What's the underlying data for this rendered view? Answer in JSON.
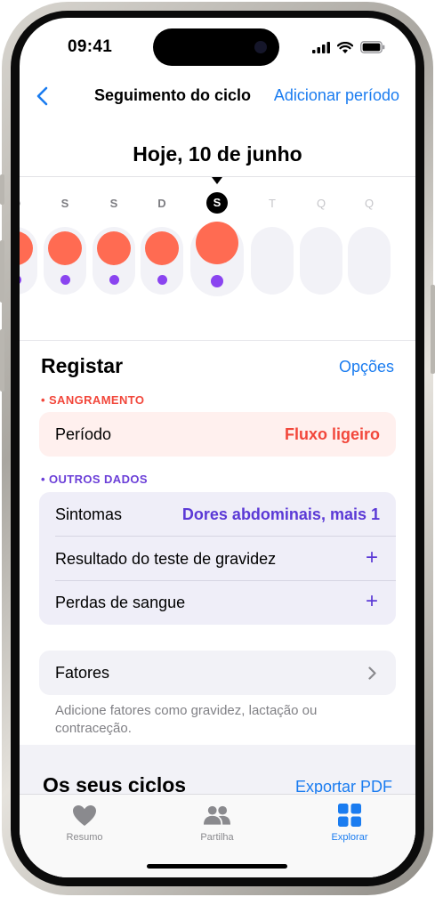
{
  "status_bar": {
    "time": "09:41"
  },
  "nav": {
    "back_icon": "chevron-left-icon",
    "title": "Seguimento do ciclo",
    "action": "Adicionar período"
  },
  "calendar": {
    "date_heading": "Hoje, 10 de junho",
    "days": [
      {
        "weekday": "Q",
        "state": "past",
        "flow": true,
        "symptom": true
      },
      {
        "weekday": "S",
        "state": "past",
        "flow": true,
        "symptom": true
      },
      {
        "weekday": "S",
        "state": "past",
        "flow": true,
        "symptom": true
      },
      {
        "weekday": "D",
        "state": "past",
        "flow": true,
        "symptom": true
      },
      {
        "weekday": "S",
        "state": "today",
        "flow": true,
        "symptom": true
      },
      {
        "weekday": "T",
        "state": "future",
        "flow": false,
        "symptom": false
      },
      {
        "weekday": "Q",
        "state": "future",
        "flow": false,
        "symptom": false
      },
      {
        "weekday": "Q",
        "state": "future",
        "flow": false,
        "symptom": false
      }
    ],
    "colors": {
      "flow": "#ff6b52",
      "symptom": "#8a44f0",
      "pill": "#f2f2f7"
    }
  },
  "log": {
    "title": "Registar",
    "options": "Opções",
    "bleeding": {
      "label": "SANGRAMENTO",
      "rows": [
        {
          "label": "Período",
          "value": "Fluxo ligeiro"
        }
      ]
    },
    "other": {
      "label": "OUTROS DADOS",
      "rows": [
        {
          "label": "Sintomas",
          "value": "Dores abdominais, mais 1"
        },
        {
          "label": "Resultado do teste de gravidez",
          "value": "+"
        },
        {
          "label": "Perdas de sangue",
          "value": "+"
        }
      ]
    },
    "factors": {
      "label": "Fatores",
      "note": "Adicione fatores como gravidez, lactação ou contraceção."
    }
  },
  "cycles": {
    "title": "Os seus ciclos",
    "export": "Exportar PDF"
  },
  "tabs": [
    {
      "label": "Resumo",
      "icon": "heart-icon",
      "active": false
    },
    {
      "label": "Partilha",
      "icon": "people-icon",
      "active": false
    },
    {
      "label": "Explorar",
      "icon": "grid-icon",
      "active": true
    }
  ],
  "colors": {
    "accent": "#1a7cf0",
    "bleeding": "#f2473b",
    "other_data": "#6b3fd8"
  }
}
